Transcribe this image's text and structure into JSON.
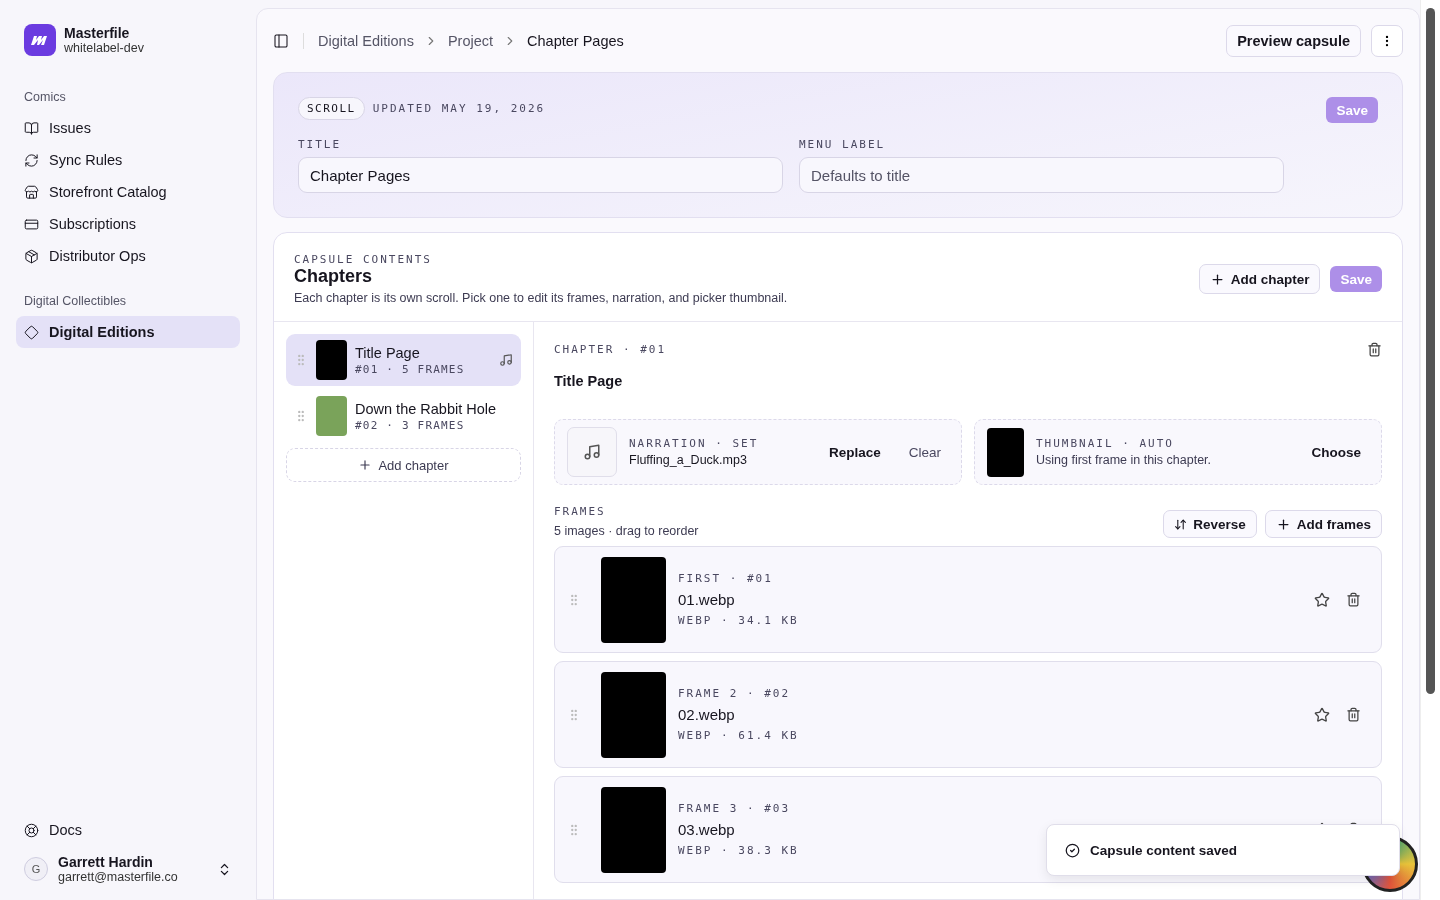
{
  "sidebar": {
    "brand": {
      "name": "Masterfile",
      "workspace": "whitelabel-dev"
    },
    "sections": [
      {
        "heading": "Comics",
        "items": [
          {
            "label": "Issues",
            "selected": false
          },
          {
            "label": "Sync Rules",
            "selected": false
          },
          {
            "label": "Storefront Catalog",
            "selected": false
          },
          {
            "label": "Subscriptions",
            "selected": false
          },
          {
            "label": "Distributor Ops",
            "selected": false
          }
        ]
      },
      {
        "heading": "Digital Collectibles",
        "items": [
          {
            "label": "Digital Editions",
            "selected": true
          }
        ]
      }
    ],
    "footer": {
      "docs": "Docs",
      "user": {
        "initial": "G",
        "name": "Garrett Hardin",
        "email": "garrett@masterfile.co"
      }
    }
  },
  "topbar": {
    "breadcrumbs": [
      "Digital Editions",
      "Project",
      "Chapter Pages"
    ],
    "preview_button": "Preview capsule"
  },
  "capsule": {
    "badge": "SCROLL",
    "updated": "UPDATED MAY 19, 2026",
    "save": "Save",
    "fields": [
      {
        "label": "TITLE",
        "value": "Chapter Pages"
      },
      {
        "label": "MENU LABEL",
        "placeholder": "Defaults to title"
      }
    ]
  },
  "contents": {
    "eyebrow": "CAPSULE CONTENTS",
    "title": "Chapters",
    "description": "Each chapter is its own scroll. Pick one to edit its frames, narration, and picker thumbnail.",
    "add_chapter": "Add chapter",
    "save": "Save",
    "chapters": [
      {
        "title": "Title Page",
        "meta": "#01 · 5 FRAMES",
        "selected": true,
        "narration": true
      },
      {
        "title": "Down the Rabbit Hole",
        "meta": "#02 · 3 FRAMES",
        "selected": false,
        "narration": false
      }
    ],
    "add_chapter_row": "Add chapter"
  },
  "chapter": {
    "eyebrow": "CHAPTER · #01",
    "title": "Title Page",
    "narration": {
      "label": "NARRATION · SET",
      "file": "Fluffing_a_Duck.mp3",
      "actions": [
        "Replace",
        "Clear"
      ]
    },
    "thumbnail": {
      "label": "THUMBNAIL · AUTO",
      "text": "Using first frame in this chapter.",
      "action": "Choose"
    },
    "frames_label": "FRAMES",
    "frames_hint": "5 images · drag to reorder",
    "reverse": "Reverse",
    "add_frames": "Add frames",
    "frames": [
      {
        "label": "FIRST · #01",
        "file": "01.webp",
        "meta": "WEBP · 34.1 KB"
      },
      {
        "label": "FRAME 2 · #02",
        "file": "02.webp",
        "meta": "WEBP · 61.4 KB"
      },
      {
        "label": "FRAME 3 · #03",
        "file": "03.webp",
        "meta": "WEBP · 38.3 KB"
      }
    ]
  },
  "toast": {
    "message": "Capsule content saved"
  }
}
